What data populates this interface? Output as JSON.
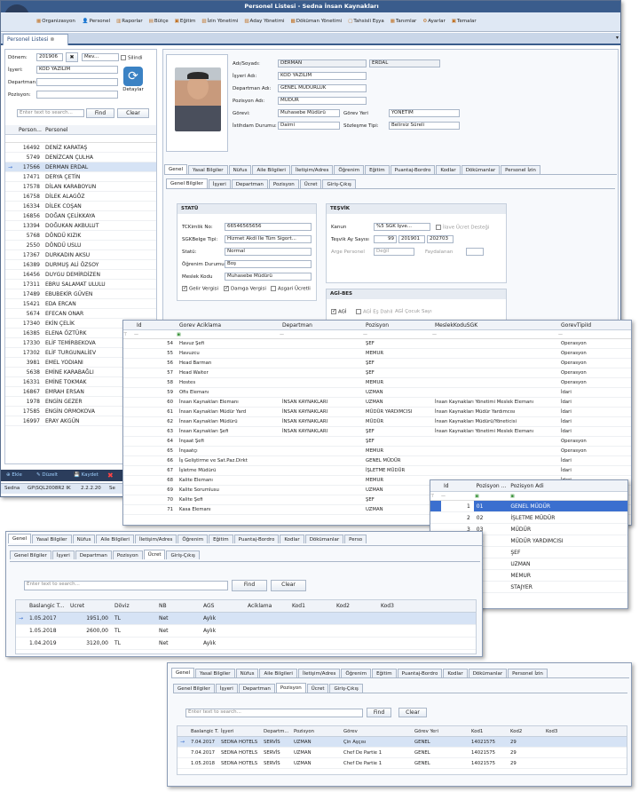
{
  "app": {
    "title": "Personel Listesi - Sedna İnsan Kaynakları",
    "menu": [
      "Organizasyon",
      "Personel",
      "Raporlar",
      "Bütçe",
      "Eğitim",
      "İzin Yönetimi",
      "Aday Yönetimi",
      "Döküman Yönetimi",
      "Tahsisli Eşya",
      "Tanımlar",
      "Ayarlar",
      "Temalar"
    ],
    "tab": "Personel Listesi"
  },
  "filters": {
    "donem_label": "Dönem:",
    "donem_value": "201906",
    "mev_value": "Mev...",
    "silindi_label": "Silindi",
    "isyeri_label": "İşyeri:",
    "isyeri_value": "KOD YAZILIM",
    "departman_label": "Departman:",
    "pozisyon_label": "Pozisyon:",
    "detaylar_label": "Detaylar",
    "search_placeholder": "Enter text to search...",
    "find_label": "Find",
    "clear_label": "Clear"
  },
  "list": {
    "col1": "Person...",
    "col2": "Personel",
    "rows": [
      [
        "16492",
        "DENİZ KARATAŞ"
      ],
      [
        "5749",
        "DENİZCAN ÇULHA"
      ],
      [
        "17566",
        "DERMAN ERDAL"
      ],
      [
        "17471",
        "DERYA ÇETİN"
      ],
      [
        "17578",
        "DİLAN KARABOYUN"
      ],
      [
        "16758",
        "DİLEK ALAGÖZ"
      ],
      [
        "16334",
        "DİLEK COŞAN"
      ],
      [
        "16856",
        "DOĞAN ÇELİKKAYA"
      ],
      [
        "13394",
        "DOĞUKAN AKBULUT"
      ],
      [
        "5768",
        "DÖNDÜ KIZIK"
      ],
      [
        "2550",
        "DÖNDÜ USLU"
      ],
      [
        "17367",
        "DURKADIN AKSU"
      ],
      [
        "16389",
        "DURMUŞ ALİ ÖZSOY"
      ],
      [
        "16456",
        "DUYGU DEMİRDİZEN"
      ],
      [
        "17311",
        "EBRU SALAMAT ULULU"
      ],
      [
        "17489",
        "EBUBEKİR GÜVEN"
      ],
      [
        "15421",
        "EDA ERCAN"
      ],
      [
        "5674",
        "EFECAN ONAR"
      ],
      [
        "17340",
        "EKİN ÇELİK"
      ],
      [
        "16385",
        "ELENA ÖZTÜRK"
      ],
      [
        "17330",
        "ELİF TEMİRBEKOVA"
      ],
      [
        "17302",
        "ELİF TURGUNALİEV"
      ],
      [
        "3981",
        "EMEL YODIANI"
      ],
      [
        "5638",
        "EMİNE KARABAĞLI"
      ],
      [
        "16331",
        "EMİNE TOKMAK"
      ],
      [
        "16867",
        "EMRAH ERSAN"
      ],
      [
        "1978",
        "ENGİN GEZER"
      ],
      [
        "17585",
        "ENGİN ORMOKOVA"
      ],
      [
        "16997",
        "ERAY AKGÜN"
      ]
    ]
  },
  "bottom": {
    "b1": "Ekle",
    "b2": "Düzelt",
    "b3": "Kaydet",
    "status": [
      "Sedna",
      "GP\\SQL2008R2 IK",
      "2.2.2.20",
      "Se"
    ]
  },
  "person": {
    "adsoyad_label": "Adı/Soyadı:",
    "ad": "DERMAN",
    "soyad": "ERDAL",
    "isyeri_label": "İşyeri Adı:",
    "isyeri": "KOD YAZILIM",
    "dep_label": "Departman Adı:",
    "dep": "GENEL MÜDÜRLÜK",
    "poz_label": "Pozisyon Adı:",
    "poz": "MÜDÜR",
    "gorev_label": "Görevi:",
    "gorev": "Muhasebe Müdürü",
    "gorevyeri_label": "Görev Yeri",
    "gorevyeri": "YÖNETİM",
    "istihdam_label": "İstihdam Durumu:",
    "istihdam": "Daimi",
    "sozlesme_label": "Sözleşme Tipi:",
    "sozlesme": "Belirsiz Süreli"
  },
  "tabs1": [
    "Genel",
    "Yasal Bilgiler",
    "Nüfus",
    "Aile Bilgileri",
    "İletişim/Adres",
    "Öğrenim",
    "Eğitim",
    "Puantaj-Bordro",
    "Kodlar",
    "Dökümanlar",
    "Personel İzin"
  ],
  "tabs2": [
    "Genel Bilgiler",
    "İşyeri",
    "Departman",
    "Pozisyon",
    "Ücret",
    "Giriş-Çıkış"
  ],
  "statu": {
    "title": "STATÜ",
    "tc_label": "TCKimlik No:",
    "tc": "66546565656",
    "sgk_label": "SGKBelge Tipi:",
    "sgk": "Hizmet Akdi İle Tüm Sigort...",
    "statu_label": "Statü:",
    "statu": "Normal",
    "ogrenim_label": "Öğrenim Durumu:",
    "ogrenim": "Boş",
    "meslek_label": "Meslek Kodu",
    "meslek": "Muhasebe Müdürü",
    "c1": "Gelir Vergisi",
    "c2": "Damga Vergisi",
    "c3": "Asgari Ücretli"
  },
  "tesvik": {
    "title": "TEŞVİK",
    "kanun_label": "Kanun",
    "kanun": "%5 SGK İşve...",
    "ilave": "İlave Ücret Desteği",
    "ay_label": "Teşvik Ay Sayısı",
    "ay": "99",
    "ay2": "201901",
    "ay3": "202703",
    "arge_label": "Arge Personel",
    "arge": "Değil",
    "fayda_label": "Faydalanan",
    "agi_title": "AGİ-BES",
    "agi": "AGİ",
    "agi_es": "AGİ Eş Dahil",
    "agi_cocuk": "AGİ Çocuk Sayı"
  },
  "gorevgrid": {
    "headers": [
      "Id",
      "Gorev Aciklama",
      "Departman",
      "Pozisyon",
      "MeslekKoduSGK",
      "GorevTipiId"
    ],
    "rows": [
      [
        "54",
        "Havuz Şefi",
        "",
        "ŞEF",
        "",
        "Operasyon"
      ],
      [
        "55",
        "Havuzcu",
        "",
        "MEMUR",
        "",
        "Operasyon"
      ],
      [
        "56",
        "Head Barman",
        "",
        "ŞEF",
        "",
        "Operasyon"
      ],
      [
        "57",
        "Head Waiter",
        "",
        "ŞEF",
        "",
        "Operasyon"
      ],
      [
        "58",
        "Hostes",
        "",
        "MEMUR",
        "",
        "Operasyon"
      ],
      [
        "59",
        "Ofis Elemanı",
        "",
        "UZMAN",
        "",
        "İdari"
      ],
      [
        "60",
        "İnsan Kaynakları Elemanı",
        "İNSAN KAYNAKLARI",
        "UZMAN",
        "İnsan Kaynakları Yönetimi Meslek Elemanı",
        "İdari"
      ],
      [
        "61",
        "İnsan Kaynakları Müdür Yard",
        "İNSAN KAYNAKLARI",
        "MÜDÜR YARDIMCISI",
        "İnsan Kaynakları Müdür Yardımcısı",
        "İdari"
      ],
      [
        "62",
        "İnsan Kaynakları Müdürü",
        "İNSAN KAYNAKLARI",
        "MÜDÜR",
        "İnsan Kaynakları Müdürü/Yöneticisi",
        "İdari"
      ],
      [
        "63",
        "İnsan Kaynakları Şefi",
        "İNSAN KAYNAKLARI",
        "ŞEF",
        "İnsan Kaynakları Yönetimi Meslek Elemanı",
        "İdari"
      ],
      [
        "64",
        "İnşaat Şefi",
        "",
        "ŞEF",
        "",
        "Operasyon"
      ],
      [
        "65",
        "İnşaatçı",
        "",
        "MEMUR",
        "",
        "Operasyon"
      ],
      [
        "66",
        "İş Geliştirme ve Sat.Paz.Dirkt",
        "",
        "GENEL MÜDÜR",
        "",
        "İdari"
      ],
      [
        "67",
        "İşletme Müdürü",
        "",
        "İŞLETME MÜDÜR",
        "",
        "İdari"
      ],
      [
        "68",
        "Kalite Elemanı",
        "",
        "MEMUR",
        "",
        "İdari"
      ],
      [
        "69",
        "Kalite Sorumlusu",
        "",
        "UZMAN",
        "",
        "İdari"
      ],
      [
        "70",
        "Kalite Şefi",
        "",
        "ŞEF",
        "",
        "İdari"
      ],
      [
        "71",
        "Kasa Elemanı",
        "",
        "UZMAN",
        "",
        "İdari"
      ]
    ]
  },
  "pozgrid": {
    "headers": [
      "Id",
      "Pozisyon ...",
      "Pozisyon Adi"
    ],
    "rows": [
      [
        "1",
        "01",
        "GENEL MÜDÜR"
      ],
      [
        "2",
        "02",
        "İŞLETME MÜDÜR"
      ],
      [
        "3",
        "03",
        "MÜDÜR"
      ],
      [
        "4",
        "04",
        "MÜDÜR YARDIMCISI"
      ],
      [
        "5",
        "05",
        "ŞEF"
      ],
      [
        "6",
        "06",
        "UZMAN"
      ],
      [
        "7",
        "07",
        "MEMUR"
      ],
      [
        "8",
        "08",
        "STAJYER"
      ]
    ]
  },
  "ucret": {
    "tabs1": [
      "Genel",
      "Yasal Bilgiler",
      "Nüfus",
      "Aile Bilgileri",
      "İletişim/Adres",
      "Öğrenim",
      "Eğitim",
      "Puantaj-Bordro",
      "Kodlar",
      "Dökümanlar",
      "Perso"
    ],
    "search": "Enter text to search...",
    "find": "Find",
    "clear": "Clear",
    "headers": [
      "Baslangic T...",
      "Ucret",
      "Döviz",
      "NB",
      "AGS",
      "Aciklama",
      "Kod1",
      "Kod2",
      "Kod3"
    ],
    "rows": [
      [
        "1.05.2017",
        "1951,00",
        "TL",
        "Net",
        "Aylık"
      ],
      [
        "1.05.2018",
        "2600,00",
        "TL",
        "Net",
        "Aylık"
      ],
      [
        "1.04.2019",
        "3120,00",
        "TL",
        "Net",
        "Aylık"
      ]
    ]
  },
  "pozwin": {
    "headers": [
      "Baslangic T...",
      "İşyeri",
      "Departm...",
      "Pozisyon",
      "Görev",
      "Görev Yeri",
      "Kod1",
      "Kod2",
      "Kod3"
    ],
    "rows": [
      [
        "7.04.2017",
        "SEDNA HOTELS",
        "SERVİS",
        "UZMAN",
        "Çin Aşçısı",
        "GENEL",
        "14021575",
        "29",
        ""
      ],
      [
        "7.04.2017",
        "SEDNA HOTELS",
        "SERVİS",
        "UZMAN",
        "Chef De Partie 1",
        "GENEL",
        "14021575",
        "29",
        ""
      ],
      [
        "1.05.2018",
        "SEDNA HOTELS",
        "SERVİS",
        "UZMAN",
        "Chef De Partie 1",
        "GENEL",
        "14021575",
        "29",
        ""
      ]
    ]
  },
  "colors": {
    "titlebar": "#2f4f7f",
    "menubar": "#dfe8f4",
    "selected": "#3b6fcf"
  }
}
